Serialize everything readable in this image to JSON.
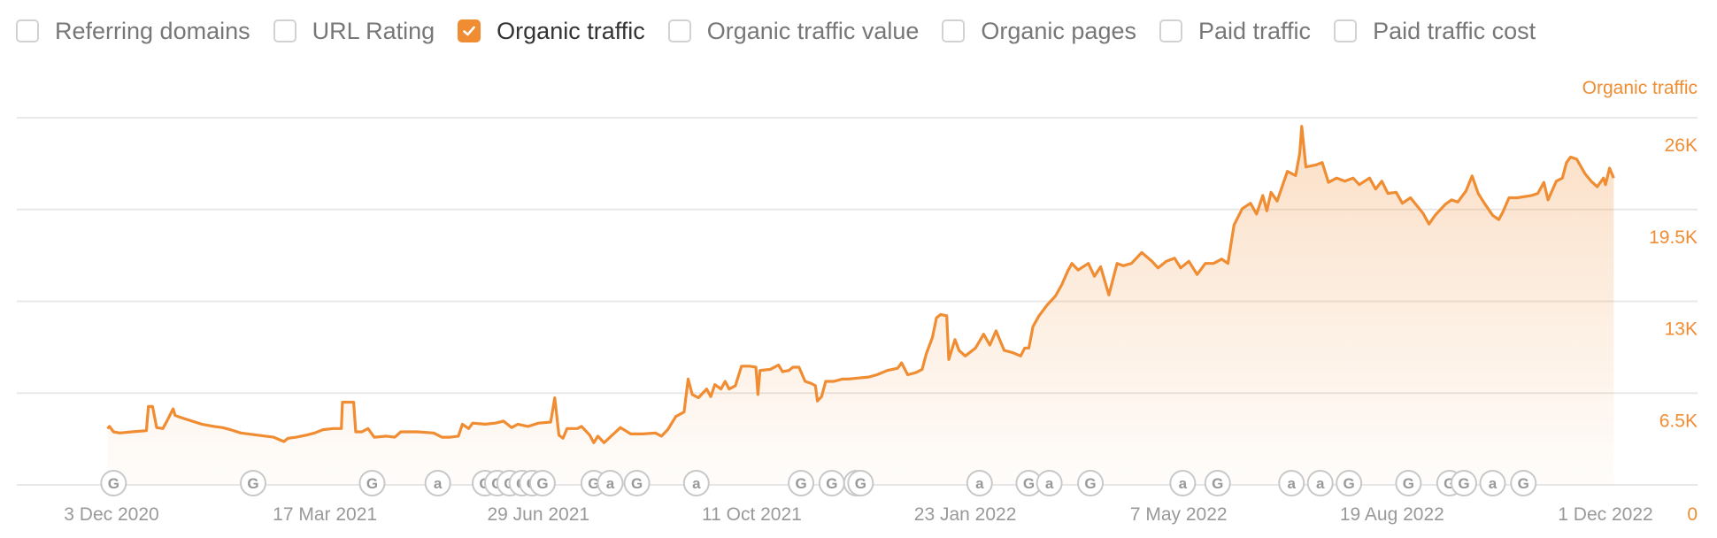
{
  "metrics": [
    {
      "label": "Referring domains",
      "checked": false
    },
    {
      "label": "URL Rating",
      "checked": false
    },
    {
      "label": "Organic traffic",
      "checked": true
    },
    {
      "label": "Organic traffic value",
      "checked": false
    },
    {
      "label": "Organic pages",
      "checked": false
    },
    {
      "label": "Paid traffic",
      "checked": false
    },
    {
      "label": "Paid traffic cost",
      "checked": false
    }
  ],
  "colors": {
    "accent": "#f08d33",
    "grid": "#e8e8e8",
    "marker": "#c8c8c8",
    "text_muted": "#999999"
  },
  "chart_data": {
    "type": "area",
    "title": "",
    "series_label": "Organic traffic",
    "xlabel": "",
    "ylabel": "Organic traffic",
    "ylim": [
      0,
      26000
    ],
    "y_ticks": [
      {
        "value": 26000,
        "label": "26K"
      },
      {
        "value": 19500,
        "label": "19.5K"
      },
      {
        "value": 13000,
        "label": "13K"
      },
      {
        "value": 6500,
        "label": "6.5K"
      },
      {
        "value": 0,
        "label": "0"
      }
    ],
    "x_ticks": [
      {
        "day": 0,
        "label": "3 Dec 2020"
      },
      {
        "day": 104,
        "label": "17 Mar 2021"
      },
      {
        "day": 208,
        "label": "29 Jun 2021"
      },
      {
        "day": 312,
        "label": "11 Oct 2021"
      },
      {
        "day": 416,
        "label": "23 Jan 2022"
      },
      {
        "day": 520,
        "label": "7 May 2022"
      },
      {
        "day": 624,
        "label": "19 Aug 2022"
      },
      {
        "day": 728,
        "label": "1 Dec 2022"
      }
    ],
    "x_unit": "days since 3 Dec 2020",
    "xlim": [
      -3,
      775
    ],
    "grid": true,
    "legend": "top-right",
    "series": [
      {
        "name": "Organic traffic",
        "points": [
          [
            -2,
            3990
          ],
          [
            -1,
            4140
          ],
          [
            1,
            3760
          ],
          [
            4,
            3680
          ],
          [
            10,
            3760
          ],
          [
            17,
            3840
          ],
          [
            18,
            5550
          ],
          [
            20,
            5550
          ],
          [
            22,
            4060
          ],
          [
            25,
            3990
          ],
          [
            27,
            4520
          ],
          [
            30,
            5390
          ],
          [
            31,
            4920
          ],
          [
            34,
            4760
          ],
          [
            39,
            4530
          ],
          [
            44,
            4300
          ],
          [
            50,
            4140
          ],
          [
            54,
            4060
          ],
          [
            58,
            3910
          ],
          [
            63,
            3680
          ],
          [
            71,
            3530
          ],
          [
            79,
            3380
          ],
          [
            84,
            3070
          ],
          [
            86,
            3300
          ],
          [
            90,
            3380
          ],
          [
            95,
            3530
          ],
          [
            99,
            3680
          ],
          [
            103,
            3910
          ],
          [
            108,
            3990
          ],
          [
            112,
            3990
          ],
          [
            112.5,
            5860
          ],
          [
            118,
            5860
          ],
          [
            119,
            3760
          ],
          [
            122,
            3760
          ],
          [
            125,
            3990
          ],
          [
            128,
            3380
          ],
          [
            134,
            3450
          ],
          [
            138,
            3380
          ],
          [
            141,
            3760
          ],
          [
            149,
            3760
          ],
          [
            157,
            3680
          ],
          [
            161,
            3380
          ],
          [
            165,
            3380
          ],
          [
            169,
            3450
          ],
          [
            171,
            4300
          ],
          [
            174,
            3990
          ],
          [
            176,
            4370
          ],
          [
            182,
            4300
          ],
          [
            187,
            4370
          ],
          [
            191,
            4520
          ],
          [
            195,
            4060
          ],
          [
            198,
            4300
          ],
          [
            203,
            4140
          ],
          [
            208,
            4370
          ],
          [
            214,
            4450
          ],
          [
            216,
            6170
          ],
          [
            218,
            3530
          ],
          [
            220,
            3300
          ],
          [
            222,
            3990
          ],
          [
            227,
            3990
          ],
          [
            229,
            4140
          ],
          [
            233,
            3530
          ],
          [
            235,
            2990
          ],
          [
            237,
            3450
          ],
          [
            240,
            2990
          ],
          [
            244,
            3530
          ],
          [
            248,
            4060
          ],
          [
            253,
            3610
          ],
          [
            259,
            3610
          ],
          [
            265,
            3680
          ],
          [
            268,
            3450
          ],
          [
            271,
            3910
          ],
          [
            275,
            4840
          ],
          [
            279,
            5160
          ],
          [
            281,
            7490
          ],
          [
            283,
            6400
          ],
          [
            286,
            6170
          ],
          [
            290,
            6790
          ],
          [
            292,
            6250
          ],
          [
            294,
            7100
          ],
          [
            297,
            6790
          ],
          [
            299,
            7330
          ],
          [
            301,
            6790
          ],
          [
            304,
            7020
          ],
          [
            307,
            8410
          ],
          [
            311,
            8410
          ],
          [
            314,
            8330
          ],
          [
            315,
            6400
          ],
          [
            316,
            8100
          ],
          [
            321,
            8180
          ],
          [
            325,
            8490
          ],
          [
            327,
            8020
          ],
          [
            330,
            8100
          ],
          [
            332,
            8330
          ],
          [
            335,
            8330
          ],
          [
            338,
            7330
          ],
          [
            341,
            7180
          ],
          [
            343,
            7020
          ],
          [
            344,
            5940
          ],
          [
            346,
            6250
          ],
          [
            348,
            7330
          ],
          [
            352,
            7330
          ],
          [
            356,
            7490
          ],
          [
            359,
            7490
          ],
          [
            364,
            7570
          ],
          [
            369,
            7640
          ],
          [
            373,
            7800
          ],
          [
            378,
            8100
          ],
          [
            383,
            8260
          ],
          [
            385,
            8640
          ],
          [
            388,
            7800
          ],
          [
            392,
            7950
          ],
          [
            395,
            8180
          ],
          [
            397,
            9260
          ],
          [
            400,
            10440
          ],
          [
            402,
            11830
          ],
          [
            404,
            12060
          ],
          [
            407,
            11980
          ],
          [
            408,
            8880
          ],
          [
            411,
            10290
          ],
          [
            413,
            9520
          ],
          [
            416,
            9130
          ],
          [
            421,
            9690
          ],
          [
            425,
            10670
          ],
          [
            428,
            9900
          ],
          [
            431,
            10910
          ],
          [
            435,
            9520
          ],
          [
            439,
            9370
          ],
          [
            443,
            9130
          ],
          [
            445,
            9690
          ],
          [
            447,
            9690
          ],
          [
            449,
            11210
          ],
          [
            452,
            11980
          ],
          [
            456,
            12750
          ],
          [
            460,
            13380
          ],
          [
            463,
            14150
          ],
          [
            466,
            15150
          ],
          [
            468,
            15680
          ],
          [
            471,
            15220
          ],
          [
            476,
            15680
          ],
          [
            479,
            14770
          ],
          [
            482,
            15450
          ],
          [
            486,
            13450
          ],
          [
            490,
            15680
          ],
          [
            493,
            15520
          ],
          [
            497,
            15680
          ],
          [
            502,
            16450
          ],
          [
            507,
            15830
          ],
          [
            510,
            15360
          ],
          [
            514,
            15830
          ],
          [
            518,
            16060
          ],
          [
            521,
            15360
          ],
          [
            525,
            15830
          ],
          [
            529,
            14900
          ],
          [
            533,
            15680
          ],
          [
            537,
            15680
          ],
          [
            541,
            15990
          ],
          [
            544,
            15680
          ],
          [
            547,
            18400
          ],
          [
            551,
            19560
          ],
          [
            555,
            19940
          ],
          [
            558,
            19180
          ],
          [
            561,
            20490
          ],
          [
            563,
            19400
          ],
          [
            565,
            20720
          ],
          [
            568,
            20100
          ],
          [
            573,
            22200
          ],
          [
            577,
            21900
          ],
          [
            579,
            23450
          ],
          [
            580,
            25390
          ],
          [
            582,
            22510
          ],
          [
            587,
            22660
          ],
          [
            590,
            22820
          ],
          [
            593,
            21420
          ],
          [
            597,
            21730
          ],
          [
            601,
            21500
          ],
          [
            605,
            21730
          ],
          [
            608,
            21260
          ],
          [
            613,
            21730
          ],
          [
            616,
            20950
          ],
          [
            619,
            21500
          ],
          [
            622,
            20640
          ],
          [
            626,
            20720
          ],
          [
            629,
            19940
          ],
          [
            633,
            20330
          ],
          [
            639,
            19250
          ],
          [
            642,
            18470
          ],
          [
            645,
            19090
          ],
          [
            650,
            19870
          ],
          [
            653,
            20180
          ],
          [
            656,
            20030
          ],
          [
            660,
            20800
          ],
          [
            663,
            21880
          ],
          [
            666,
            20640
          ],
          [
            669,
            19940
          ],
          [
            673,
            19090
          ],
          [
            676,
            18780
          ],
          [
            678,
            19330
          ],
          [
            681,
            20330
          ],
          [
            685,
            20330
          ],
          [
            692,
            20490
          ],
          [
            695,
            20640
          ],
          [
            698,
            21420
          ],
          [
            700,
            20180
          ],
          [
            704,
            21500
          ],
          [
            707,
            21730
          ],
          [
            709,
            22820
          ],
          [
            711,
            23210
          ],
          [
            714,
            23060
          ],
          [
            718,
            22040
          ],
          [
            721,
            21500
          ],
          [
            724,
            21110
          ],
          [
            727,
            21730
          ],
          [
            728,
            21260
          ],
          [
            730,
            22430
          ],
          [
            732,
            21730
          ]
        ]
      }
    ],
    "annotations": [
      {
        "day": 1,
        "type": "G"
      },
      {
        "day": 69,
        "type": "G"
      },
      {
        "day": 127,
        "type": "G"
      },
      {
        "day": 159,
        "type": "a"
      },
      {
        "day": 182,
        "type": "G"
      },
      {
        "day": 188,
        "type": "G"
      },
      {
        "day": 194,
        "type": "G"
      },
      {
        "day": 200,
        "type": "G"
      },
      {
        "day": 205,
        "type": "G"
      },
      {
        "day": 210,
        "type": "G"
      },
      {
        "day": 235,
        "type": "G"
      },
      {
        "day": 243,
        "type": "a"
      },
      {
        "day": 256,
        "type": "G"
      },
      {
        "day": 285,
        "type": "a"
      },
      {
        "day": 336,
        "type": "G"
      },
      {
        "day": 351,
        "type": "G"
      },
      {
        "day": 363,
        "type": "G"
      },
      {
        "day": 365,
        "type": "G"
      },
      {
        "day": 423,
        "type": "a"
      },
      {
        "day": 447,
        "type": "G"
      },
      {
        "day": 457,
        "type": "a"
      },
      {
        "day": 477,
        "type": "G"
      },
      {
        "day": 522,
        "type": "a"
      },
      {
        "day": 539,
        "type": "G"
      },
      {
        "day": 575,
        "type": "a"
      },
      {
        "day": 589,
        "type": "a"
      },
      {
        "day": 603,
        "type": "G"
      },
      {
        "day": 632,
        "type": "G"
      },
      {
        "day": 652,
        "type": "G"
      },
      {
        "day": 659,
        "type": "G"
      },
      {
        "day": 673,
        "type": "a"
      },
      {
        "day": 688,
        "type": "G"
      }
    ]
  }
}
